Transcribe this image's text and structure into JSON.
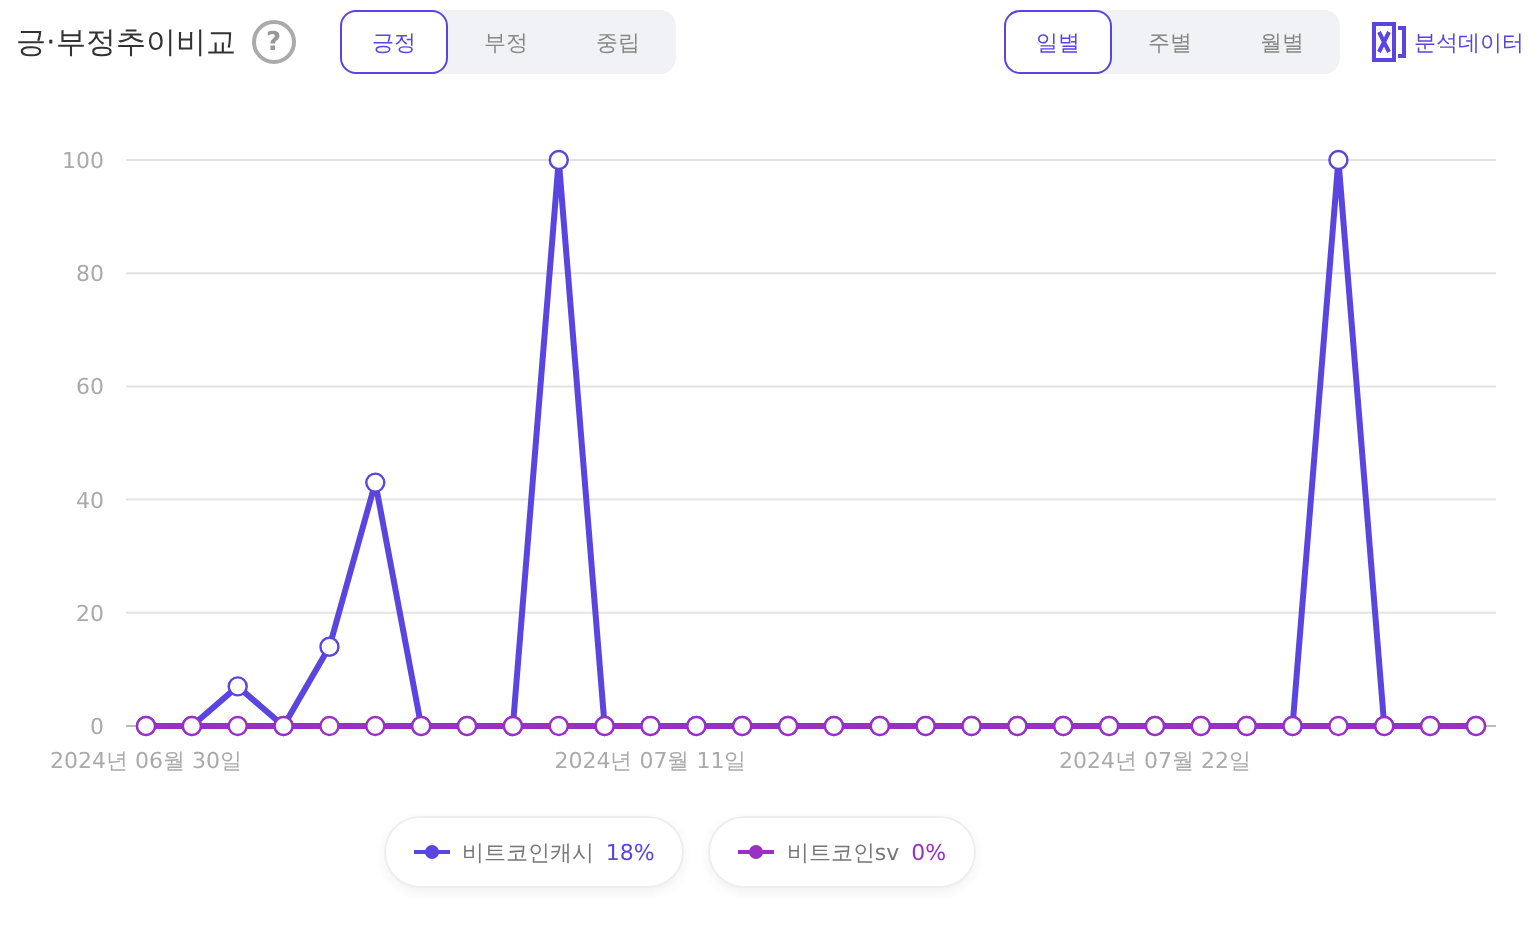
{
  "header": {
    "title": "긍·부정추이비교",
    "help_icon": "?"
  },
  "sentiment_tabs": [
    {
      "label": "긍정",
      "selected": true
    },
    {
      "label": "부정",
      "selected": false
    },
    {
      "label": "중립",
      "selected": false
    }
  ],
  "period_tabs": [
    {
      "label": "일별",
      "selected": true
    },
    {
      "label": "주별",
      "selected": false
    },
    {
      "label": "월별",
      "selected": false
    }
  ],
  "export_link": {
    "label": "분석데이터"
  },
  "chart": {
    "chart_data": {
      "type": "line",
      "ylim": [
        0,
        100
      ],
      "yticks": [
        0,
        20,
        40,
        60,
        80,
        100
      ],
      "grid": true,
      "categories": [
        "2024년 06월 30일",
        null,
        null,
        null,
        null,
        null,
        null,
        null,
        null,
        null,
        null,
        "2024년 07월 11일",
        null,
        null,
        null,
        null,
        null,
        null,
        null,
        null,
        null,
        null,
        "2024년 07월 22일",
        null,
        null,
        null,
        null,
        null,
        null,
        null
      ],
      "series": [
        {
          "name": "비트코인캐시",
          "color": "#5a45e0",
          "marker": "circle",
          "values": [
            0,
            0,
            7,
            0,
            14,
            43,
            0,
            0,
            0,
            100,
            0,
            0,
            0,
            0,
            0,
            0,
            0,
            0,
            0,
            0,
            0,
            0,
            0,
            0,
            0,
            0,
            100,
            0,
            0,
            0
          ]
        },
        {
          "name": "비트코인sv",
          "color": "#9a2fc6",
          "marker": "circle",
          "values": [
            0,
            0,
            0,
            0,
            0,
            0,
            0,
            0,
            0,
            0,
            0,
            0,
            0,
            0,
            0,
            0,
            0,
            0,
            0,
            0,
            0,
            0,
            0,
            0,
            0,
            0,
            0,
            0,
            0,
            0
          ]
        }
      ]
    }
  },
  "legend": [
    {
      "share": "18%"
    },
    {
      "share": "0%"
    }
  ]
}
